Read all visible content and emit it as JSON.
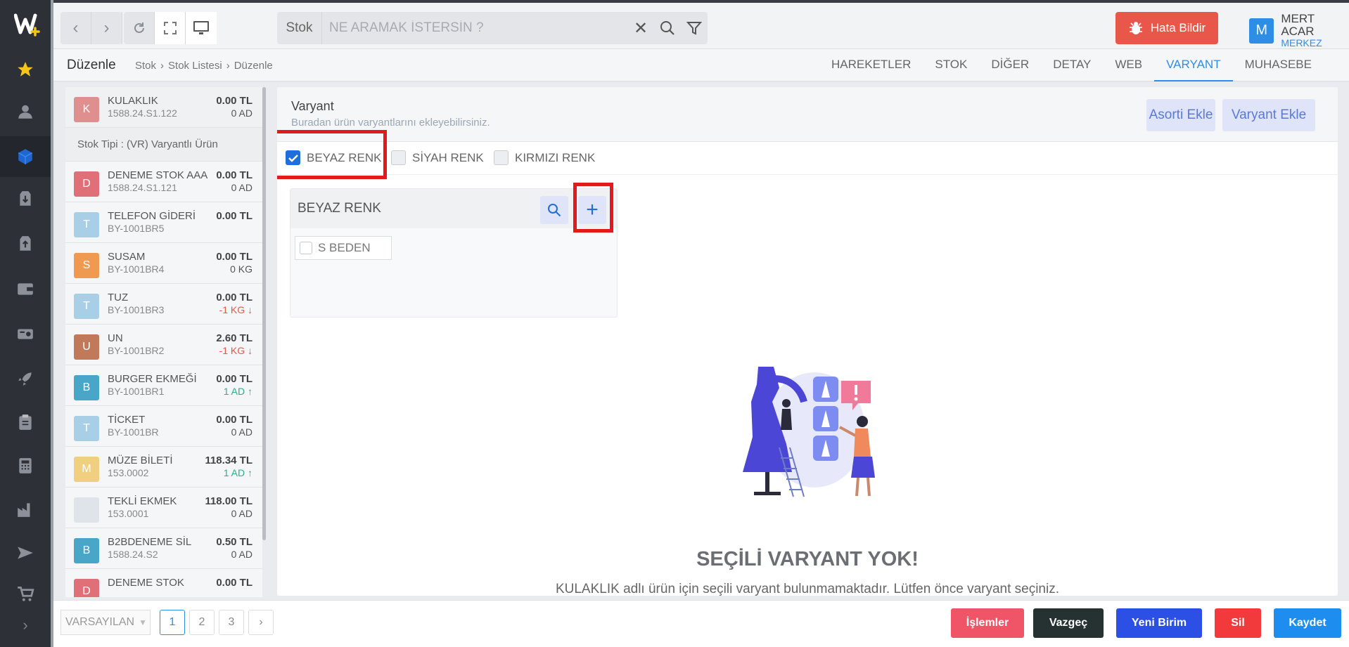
{
  "topbar": {
    "search_category": "Stok",
    "search_placeholder": "NE ARAMAK İSTERSİN ?",
    "bug_report_label": "Hata Bildir",
    "user_initial": "M",
    "user_name": "MERT ACAR",
    "user_branch": "MERKEZ"
  },
  "subbar": {
    "title": "Düzenle",
    "breadcrumb": [
      "Stok",
      "Stok Listesi",
      "Düzenle"
    ],
    "tabs": [
      "HAREKETLER",
      "STOK",
      "DİĞER",
      "DETAY",
      "WEB",
      "VARYANT",
      "MUHASEBE"
    ],
    "active_tab": "VARYANT"
  },
  "stock_list": {
    "selected": {
      "initial": "K",
      "name": "KULAKLIK",
      "code": "1588.24.S1.122",
      "price": "0.00 TL",
      "qty": "0 AD",
      "color": "#e08f8f"
    },
    "stock_type": "Stok Tipi :  (VR) Varyantlı Ürün",
    "items": [
      {
        "initial": "D",
        "name": "DENEME STOK AAA",
        "code": "1588.24.S1.121",
        "price": "0.00 TL",
        "qty": "0 AD",
        "qty_state": "",
        "color": "#e07078"
      },
      {
        "initial": "T",
        "name": "TELEFON GİDERİ",
        "code": "BY-1001BR5",
        "price": "0.00 TL",
        "qty": "",
        "qty_state": "",
        "color": "#a8cfe6"
      },
      {
        "initial": "S",
        "name": "SUSAM",
        "code": "BY-1001BR4",
        "price": "0.00 TL",
        "qty": "0 KG",
        "qty_state": "",
        "color": "#ef9a50"
      },
      {
        "initial": "T",
        "name": "TUZ",
        "code": "BY-1001BR3",
        "price": "0.00 TL",
        "qty": "-1 KG ↓",
        "qty_state": "neg",
        "color": "#a8cfe6"
      },
      {
        "initial": "U",
        "name": "UN",
        "code": "BY-1001BR2",
        "price": "2.60 TL",
        "qty": "-1 KG ↓",
        "qty_state": "neg",
        "color": "#c07a5a"
      },
      {
        "initial": "B",
        "name": "BURGER EKMEĞİ",
        "code": "BY-1001BR1",
        "price": "0.00 TL",
        "qty": "1 AD ↑",
        "qty_state": "pos",
        "color": "#4aa6c8"
      },
      {
        "initial": "T",
        "name": "TİCKET",
        "code": "BY-1001BR",
        "price": "0.00 TL",
        "qty": "0 AD",
        "qty_state": "",
        "color": "#a8cfe6"
      },
      {
        "initial": "M",
        "name": "MÜZE BİLETİ",
        "code": "153.0002",
        "price": "118.34 TL",
        "qty": "1 AD ↑",
        "qty_state": "pos",
        "color": "#f0cf80"
      },
      {
        "initial": "",
        "name": "TEKLİ EKMEK",
        "code": "153.0001",
        "price": "118.00 TL",
        "qty": "0 AD",
        "qty_state": "",
        "color": "#dfe3ea"
      },
      {
        "initial": "B",
        "name": "B2BDENEME SİL",
        "code": "1588.24.S2",
        "price": "0.50 TL",
        "qty": "0 AD",
        "qty_state": "",
        "color": "#4aa6c8"
      },
      {
        "initial": "D",
        "name": "DENEME STOK",
        "code": "",
        "price": "0.00 TL",
        "qty": "",
        "qty_state": "",
        "color": "#e07078"
      }
    ]
  },
  "variant": {
    "title": "Varyant",
    "subtitle": "Buradan ürün varyantlarını ekleyebilirsiniz.",
    "assort_button": "Asorti Ekle",
    "add_variant_button": "Varyant Ekle",
    "options": [
      {
        "label": "BEYAZ RENK",
        "checked": true
      },
      {
        "label": "SİYAH RENK",
        "checked": false
      },
      {
        "label": "KIRMIZI RENK",
        "checked": false
      }
    ],
    "card_title": "BEYAZ RENK",
    "card_items": [
      "S BEDEN"
    ],
    "empty_title": "SEÇİLİ VARYANT YOK!",
    "empty_text": "KULAKLIK adlı ürün için seçili varyant bulunmamaktadır. Lütfen önce varyant seçiniz."
  },
  "bottombar": {
    "dropdown_value": "VARSAYILAN",
    "pages": [
      "1",
      "2",
      "3"
    ],
    "current_page": "1",
    "buttons": {
      "islemler": "İşlemler",
      "vazgec": "Vazgeç",
      "yeni_birim": "Yeni Birim",
      "sil": "Sil",
      "kaydet": "Kaydet"
    }
  },
  "colors": {
    "accent": "#2e8ee6",
    "highlight": "#e11b1b",
    "btn_islemler": "#ef5467",
    "btn_vazgec": "#253231",
    "btn_yeni_birim": "#2c4fe6",
    "btn_sil": "#f2393b",
    "btn_kaydet": "#1d8ef0"
  }
}
